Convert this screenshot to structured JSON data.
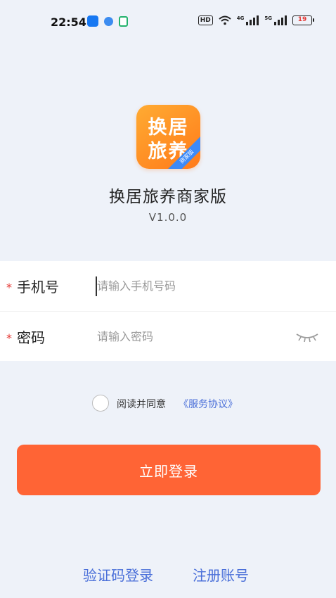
{
  "status_bar": {
    "time": "22:54",
    "network_badge": "HD",
    "signal1_label": "4G",
    "signal2_label": "5G",
    "battery_level": "19"
  },
  "app": {
    "logo_text_line1": "换居",
    "logo_text_line2": "旅养",
    "logo_ribbon": "商家版",
    "name": "换居旅养商家版",
    "version": "V1.0.0"
  },
  "form": {
    "required_mark": "*",
    "phone": {
      "label": "手机号",
      "placeholder": "请输入手机号码",
      "value": ""
    },
    "password": {
      "label": "密码",
      "placeholder": "请输入密码",
      "value": ""
    }
  },
  "agreement": {
    "text": "阅读并同意",
    "link": "《服务协议》",
    "checked": false
  },
  "login_button": {
    "label": "立即登录"
  },
  "bottom_links": {
    "sms_login": "验证码登录",
    "register": "注册账号"
  },
  "colors": {
    "background": "#eef2f9",
    "primary_button": "#ff6435",
    "link": "#4a6fd9",
    "required": "#e53935"
  },
  "icons": [
    "eye-closed-icon",
    "wifi-icon",
    "signal-icon",
    "battery-icon"
  ]
}
